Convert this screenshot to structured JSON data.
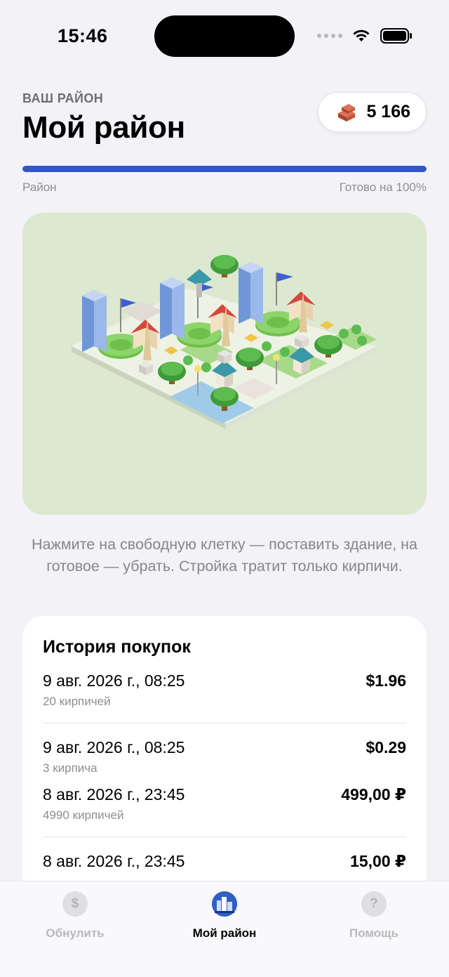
{
  "status_bar": {
    "time": "15:46"
  },
  "header": {
    "kicker": "ВАШ РАЙОН",
    "title": "Мой район"
  },
  "bricks": {
    "count": "5 166",
    "icon": "brick-icon"
  },
  "progress": {
    "label": "Район",
    "status": "Готово на 100%",
    "value": 1.0,
    "color": "#3156c8"
  },
  "hint": "Нажмите на свободную клетку — поставить здание, на готовое — убрать. Стройка тратит только кирпичи.",
  "history": {
    "title": "История покупок",
    "items": [
      {
        "date": "9 авг. 2026 г., 08:25",
        "sub": "20 кирпичей",
        "amount": "$1.96"
      },
      {
        "date": "9 авг. 2026 г., 08:25",
        "sub": "3 кирпича",
        "amount": "$0.29"
      },
      {
        "date": "8 авг. 2026 г., 23:45",
        "sub": "4990 кирпичей",
        "amount": "499,00 ₽"
      },
      {
        "date": "8 авг. 2026 г., 23:45",
        "sub": "",
        "amount": "15,00 ₽"
      }
    ]
  },
  "tabs": [
    {
      "label": "Обнулить",
      "icon": "dollar-icon",
      "active": false
    },
    {
      "label": "Мой район",
      "icon": "city-icon",
      "active": true
    },
    {
      "label": "Помощь",
      "icon": "question-icon",
      "active": false
    }
  ]
}
